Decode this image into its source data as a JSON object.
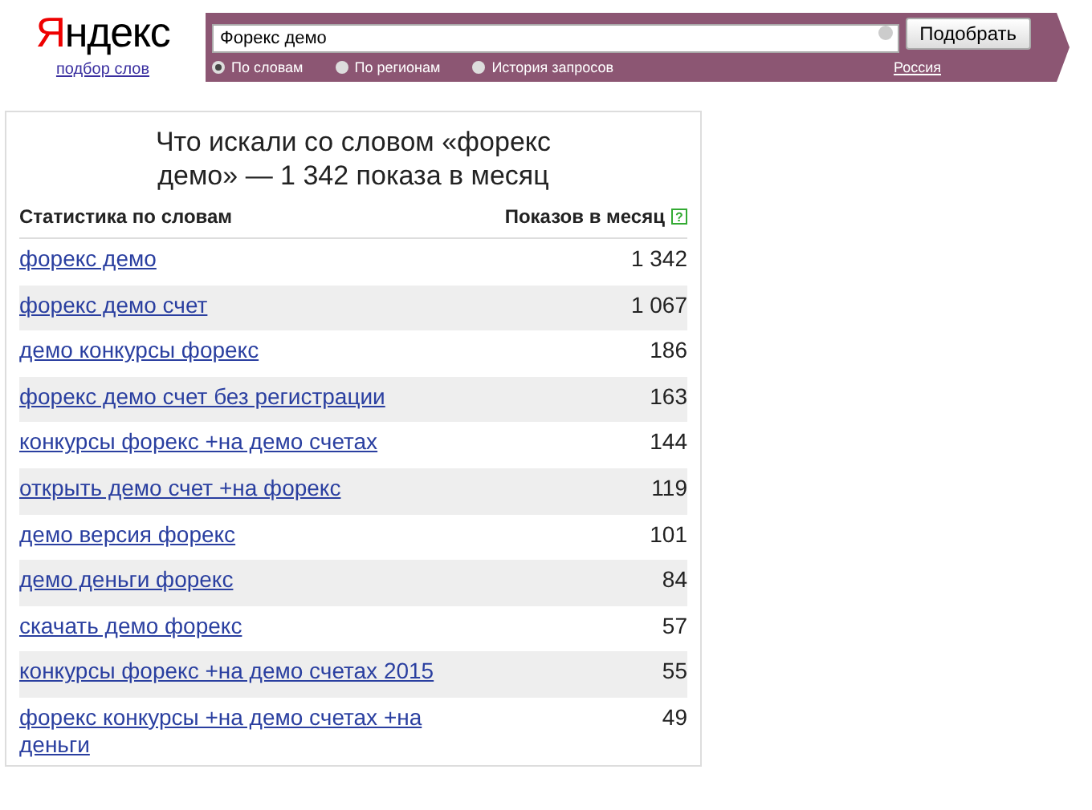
{
  "logo": {
    "initial": "Я",
    "rest": "ндекс"
  },
  "logo_link": "подбор слов",
  "search": {
    "value": "Форекс демо",
    "button": "Подобрать",
    "region": "Россия"
  },
  "modes": [
    {
      "label": "По словам",
      "selected": true
    },
    {
      "label": "По регионам",
      "selected": false
    },
    {
      "label": "История запросов",
      "selected": false
    }
  ],
  "heading": "Что искали со словом «форекс демо» — 1 342 показа в месяц",
  "table": {
    "columns": [
      "Статистика по словам",
      "Показов в месяц"
    ],
    "help": "?",
    "rows": [
      {
        "phrase": "форекс демо",
        "count": "1 342"
      },
      {
        "phrase": "форекс демо счет",
        "count": "1 067"
      },
      {
        "phrase": "демо конкурсы форекс",
        "count": "186"
      },
      {
        "phrase": "форекс демо счет без регистрации",
        "count": "163"
      },
      {
        "phrase": "конкурсы форекс +на демо счетах",
        "count": "144"
      },
      {
        "phrase": "открыть демо счет +на форекс",
        "count": "119"
      },
      {
        "phrase": "демо версия форекс",
        "count": "101"
      },
      {
        "phrase": "демо деньги форекс",
        "count": "84"
      },
      {
        "phrase": "скачать демо форекс",
        "count": "57"
      },
      {
        "phrase": "конкурсы форекс +на демо счетах 2015",
        "count": "55"
      },
      {
        "phrase": "форекс конкурсы +на демо счетах +на деньги",
        "count": "49"
      }
    ]
  }
}
